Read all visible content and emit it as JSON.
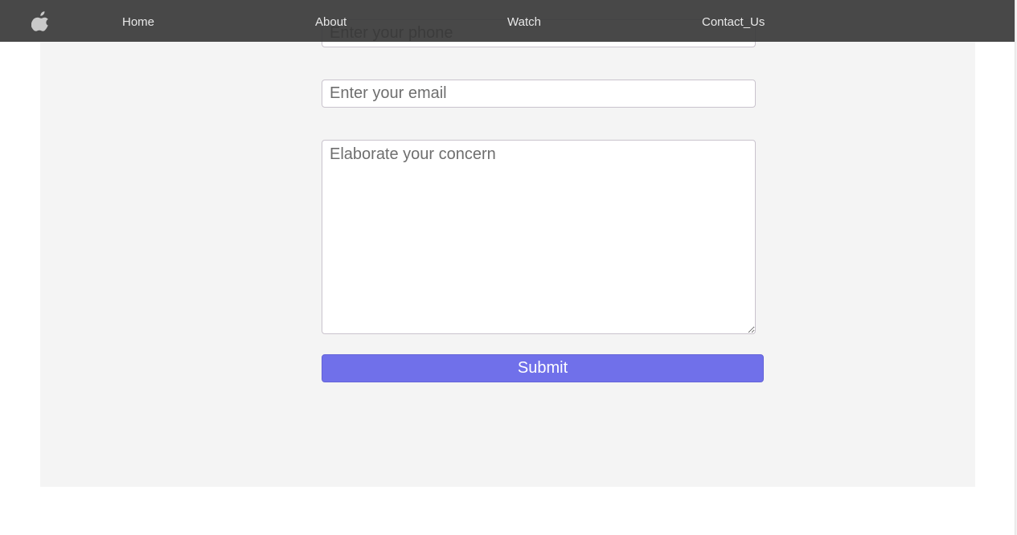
{
  "nav": {
    "logo_icon": "apple-icon",
    "links": [
      {
        "label": "Home"
      },
      {
        "label": "About"
      },
      {
        "label": "Watch"
      },
      {
        "label": "Contact_Us"
      }
    ]
  },
  "form": {
    "phone_placeholder": "Enter your phone",
    "email_placeholder": "Enter your email",
    "concern_placeholder": "Elaborate your concern",
    "submit_label": "Submit"
  },
  "colors": {
    "navbar": "#3a3a3a",
    "submit": "#7070ea",
    "panel": "#f4f4f4"
  }
}
